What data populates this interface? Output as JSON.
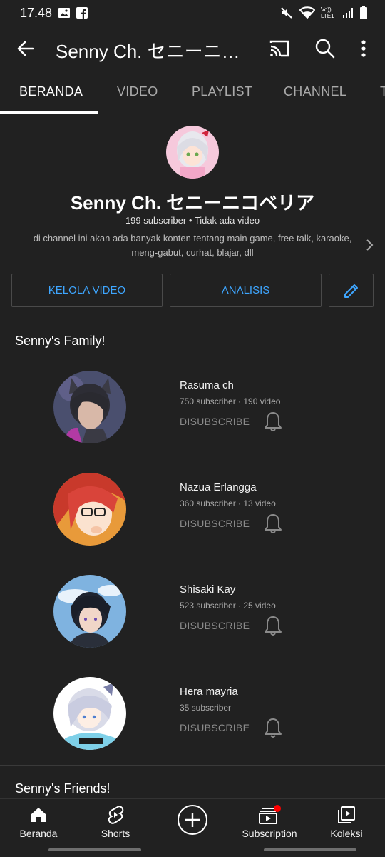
{
  "status_bar": {
    "time": "17.48",
    "network": "Vo)) LTE1"
  },
  "app_bar": {
    "title": "Senny Ch. セニーニコベリア"
  },
  "tabs": [
    {
      "label": "BERANDA",
      "active": true
    },
    {
      "label": "VIDEO",
      "active": false
    },
    {
      "label": "PLAYLIST",
      "active": false
    },
    {
      "label": "CHANNEL",
      "active": false
    },
    {
      "label": "T",
      "active": false
    }
  ],
  "channel": {
    "name": "Senny Ch. セニーニコベリア",
    "meta": "199 subscriber • Tidak ada video",
    "description": "di channel ini akan ada banyak konten tentang main game, free talk, karaoke, meng-gabut, curhat, blajar, dll"
  },
  "buttons": {
    "manage": "KELOLA VIDEO",
    "analytics": "ANALISIS"
  },
  "sections": {
    "family_title": "Senny's Family!",
    "friends_title": "Senny's Friends!"
  },
  "family": [
    {
      "name": "Rasuma ch",
      "meta": "750 subscriber · 190 video",
      "action": "DISUBSCRIBE"
    },
    {
      "name": "Nazua Erlangga",
      "meta": "360 subscriber · 13 video",
      "action": "DISUBSCRIBE"
    },
    {
      "name": "Shisaki Kay",
      "meta": "523 subscriber · 25 video",
      "action": "DISUBSCRIBE"
    },
    {
      "name": "Hera mayria",
      "meta": "35 subscriber",
      "action": "DISUBSCRIBE"
    }
  ],
  "bottom_nav": [
    {
      "label": "Beranda",
      "icon": "home-icon"
    },
    {
      "label": "Shorts",
      "icon": "shorts-icon"
    },
    {
      "label": "",
      "icon": "create-icon"
    },
    {
      "label": "Subscription",
      "icon": "subscriptions-icon"
    },
    {
      "label": "Koleksi",
      "icon": "library-icon"
    }
  ],
  "colors": {
    "background": "#212121",
    "accent": "#3ea6ff",
    "notification_dot": "#ff0000"
  }
}
